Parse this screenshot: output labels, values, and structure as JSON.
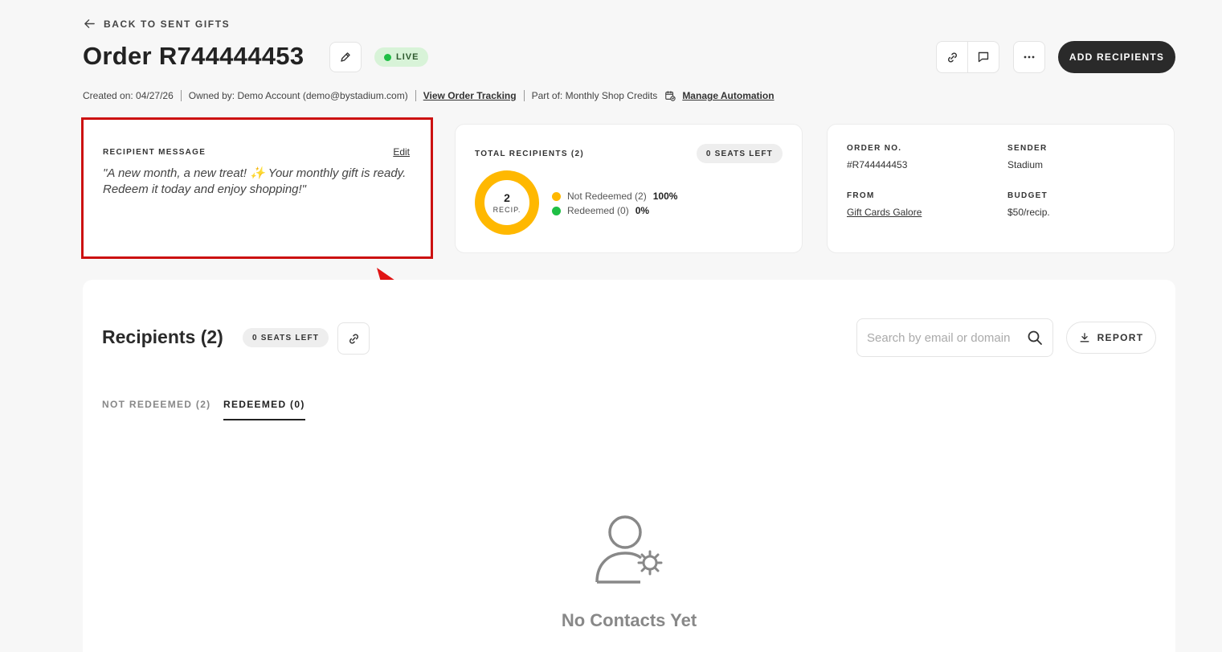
{
  "nav": {
    "back_label": "BACK TO SENT GIFTS"
  },
  "header": {
    "title": "Order R744444453",
    "status_badge": "LIVE",
    "add_recipients_label": "ADD RECIPIENTS"
  },
  "meta": {
    "created": "Created on: 04/27/26",
    "owner": "Owned by: Demo Account (demo@bystadium.com)",
    "tracking_link": "View Order Tracking",
    "part_of": "Part of: Monthly Shop Credits",
    "automation_link": "Manage Automation"
  },
  "message_card": {
    "label": "RECIPIENT MESSAGE",
    "edit_label": "Edit",
    "text": "\"A new month, a new treat! ✨ Your monthly gift is ready. Redeem it today and enjoy shopping!\""
  },
  "recipients_card": {
    "label": "TOTAL RECIPIENTS (2)",
    "seats_left": "0 SEATS LEFT",
    "donut_count": "2",
    "donut_unit": "RECIP.",
    "legend": [
      {
        "label": "Not Redeemed (2)",
        "pct": "100%",
        "color": "#ffb800"
      },
      {
        "label": "Redeemed (0)",
        "pct": "0%",
        "color": "#1fbf45"
      }
    ]
  },
  "order_card": {
    "order_no_label": "ORDER NO.",
    "order_no": "#R744444453",
    "sender_label": "SENDER",
    "sender": "Stadium",
    "from_label": "FROM",
    "from": "Gift Cards Galore",
    "budget_label": "BUDGET",
    "budget": "$50/recip."
  },
  "recipients_section": {
    "title": "Recipients (2)",
    "seats_left": "0 SEATS LEFT",
    "search_placeholder": "Search by email or domain",
    "report_label": "REPORT",
    "tabs": [
      {
        "label": "NOT REDEEMED (2)",
        "active": false
      },
      {
        "label": "REDEEMED (0)",
        "active": true
      }
    ],
    "empty_text": "No Contacts Yet"
  },
  "colors": {
    "accent_dark": "#2a2a2a",
    "live_green": "#1fbf45",
    "donut_yellow": "#ffb800",
    "highlight_red": "#cc1111"
  }
}
